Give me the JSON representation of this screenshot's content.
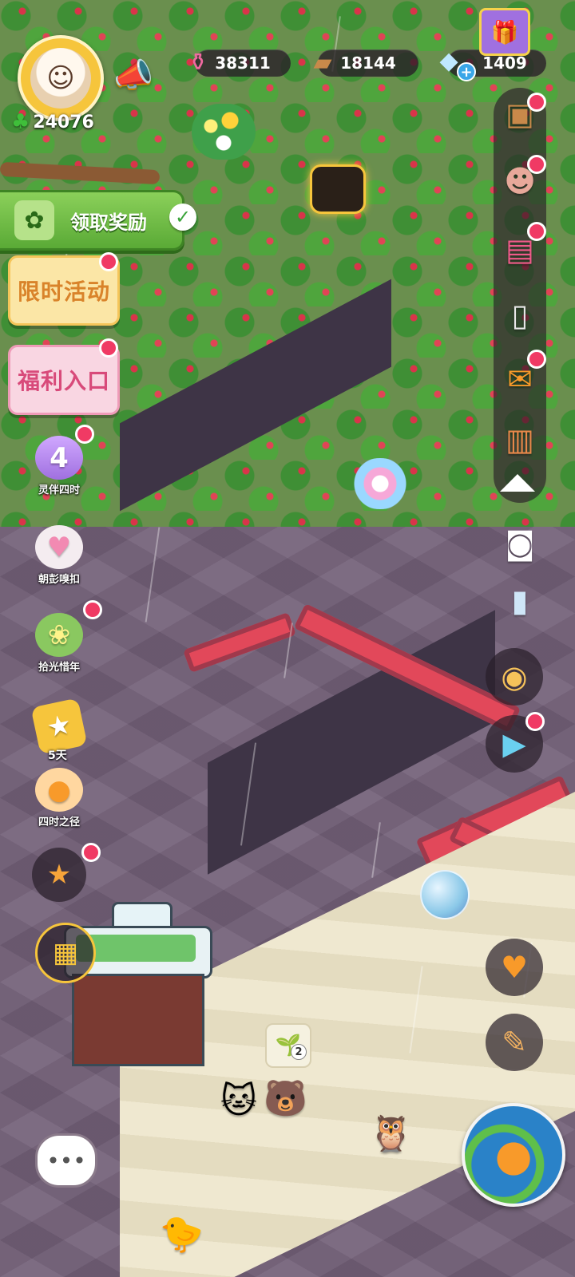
{
  "hud": {
    "clover_count": "24076",
    "resources": [
      {
        "name": "pink-potion",
        "value": "38311",
        "icon": "potion-icon",
        "color": "#f4a6c8"
      },
      {
        "name": "wood",
        "value": "18144",
        "icon": "wood-log-icon",
        "color": "#c8894a"
      },
      {
        "name": "diamond",
        "value": "1409",
        "icon": "diamond-icon",
        "color": "#bfe8ff"
      }
    ],
    "plus_symbol": "+"
  },
  "left_panel": {
    "claim_reward_label": "领取奖励",
    "limited_event_label": "限时活动",
    "welfare_label": "福利入口",
    "side_buttons": [
      {
        "id": "four-seasons-companion",
        "label": "灵伴四时",
        "glyph": "4"
      },
      {
        "id": "morning-clasp",
        "label": "朝彭嗅扣",
        "glyph": "♥"
      },
      {
        "id": "light-gathering",
        "label": "拾光惜年",
        "glyph": "❀"
      },
      {
        "id": "gold-coupon",
        "label": "5天",
        "glyph": "★"
      },
      {
        "id": "four-seasons-path",
        "label": "四时之径",
        "glyph": "●"
      }
    ]
  },
  "bottom": {
    "sprout_count": "2"
  },
  "colors": {
    "accent_green": "#5aaa36",
    "notification_red": "#f03a64",
    "lava": "#e2485a"
  }
}
